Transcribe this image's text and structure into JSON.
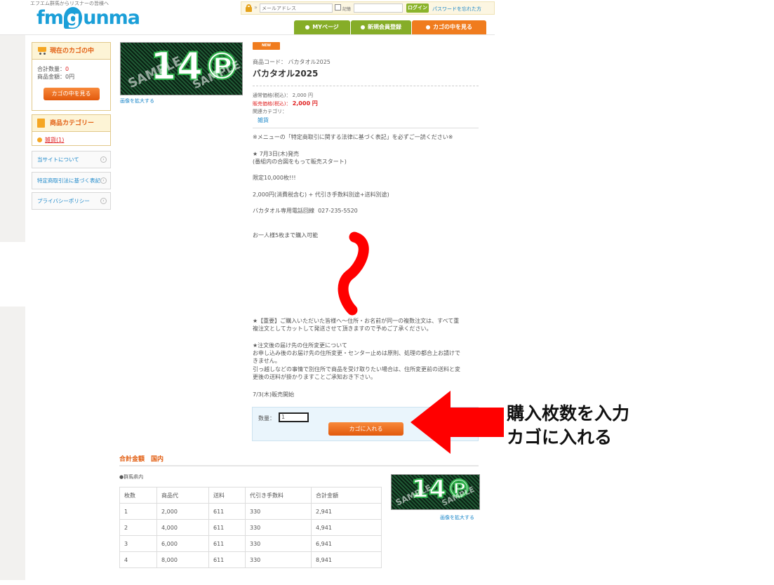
{
  "header": {
    "tagline": "エフエム群馬からリスナーの皆様へ",
    "logo": {
      "left": "fm",
      "g": "g",
      "right": "unma"
    },
    "login": {
      "email_placeholder": "メールアドレス",
      "remember_label": "記憶",
      "login_button": "ログイン",
      "forgot_link": "パスワードを忘れた方"
    },
    "nav": {
      "mypage": "MYページ",
      "register": "新規会員登録",
      "cart": "カゴの中を見る"
    }
  },
  "sidebar": {
    "cart_title": "現在のカゴの中",
    "total_qty_label": "合計数量：",
    "total_qty_value": "0",
    "total_amount_label": "商品金額：",
    "total_amount_value": "0円",
    "view_cart_button": "カゴの中を見る",
    "category_title": "商品カテゴリー",
    "category_item": "雑貨(1)",
    "links": [
      "当サイトについて",
      "特定商取引法に基づく表記",
      "プライバシーポリシー"
    ]
  },
  "image": {
    "number": "14℗",
    "watermark": "SAMPLE",
    "zoom_label": "画像を拡大する"
  },
  "product": {
    "badge": "NEW",
    "code": "商品コード： バカタオル2025",
    "title": "バカタオル2025",
    "regular_price": "通常価格(税込)： 2,000 円",
    "sale_price_label": "販売価格(税込)：",
    "sale_price_value": "2,000 円",
    "related_label": "関連カテゴリ：",
    "related_category": "雑貨",
    "notice": "※メニューの「特定商取引に関する法律に基づく表記」を必ずご一読ください※",
    "release": "★ 7月3日(木)発売",
    "release_note": "(番組内の合図をもって販売スタート)",
    "limited": "限定10,000枚!!!",
    "price_note": "2,000円(消費税含む) + 代引き手数料別途+送料別途)",
    "phone": "バカタオル専用電話回線  027-235-5520",
    "limit_per_person": "お一人様5枚まで購入可能",
    "important_1": "★【重要】ご購入いただいた皆様へ～住所・お名前が同一の複数注文は、すべて重",
    "important_2": "複注文としてカットして発送させて頂きますので予めご了承ください。",
    "address_change_title": "★注文後の届け先の住所変更について",
    "address_change_1": "お申し込み後のお届け先の住所変更・センター止めは原則、処理の都合上お請けで",
    "address_change_2": "きません。",
    "address_change_3": "引っ越しなどの事情で別住所で商品を受け取りたい場合は、住所変更前の送料と変",
    "address_change_4": "更後の送料が掛かりますことご承知おき下さい。",
    "sale_start": "7/3(木)販売開始"
  },
  "cart_form": {
    "qty_label": "数量：",
    "qty_value": "1",
    "add_button": "カゴに入れる"
  },
  "annotation": {
    "line1": "購入枚数を入力",
    "line2": "カゴに入れる"
  },
  "totals": {
    "title": "合計金額　国内",
    "region": "●群馬県内",
    "columns": [
      "枚数",
      "商品代",
      "送料",
      "代引き手数料",
      "合計金額"
    ],
    "rows": [
      [
        "1",
        "2,000",
        "611",
        "330",
        "2,941"
      ],
      [
        "2",
        "4,000",
        "611",
        "330",
        "4,941"
      ],
      [
        "3",
        "6,000",
        "611",
        "330",
        "6,941"
      ],
      [
        "4",
        "8,000",
        "611",
        "330",
        "8,941"
      ]
    ]
  },
  "colors": {
    "brand_blue": "#1b9fd8",
    "orange": "#f07c1e",
    "green": "#86ad28",
    "annotation_red": "#ff0000"
  }
}
